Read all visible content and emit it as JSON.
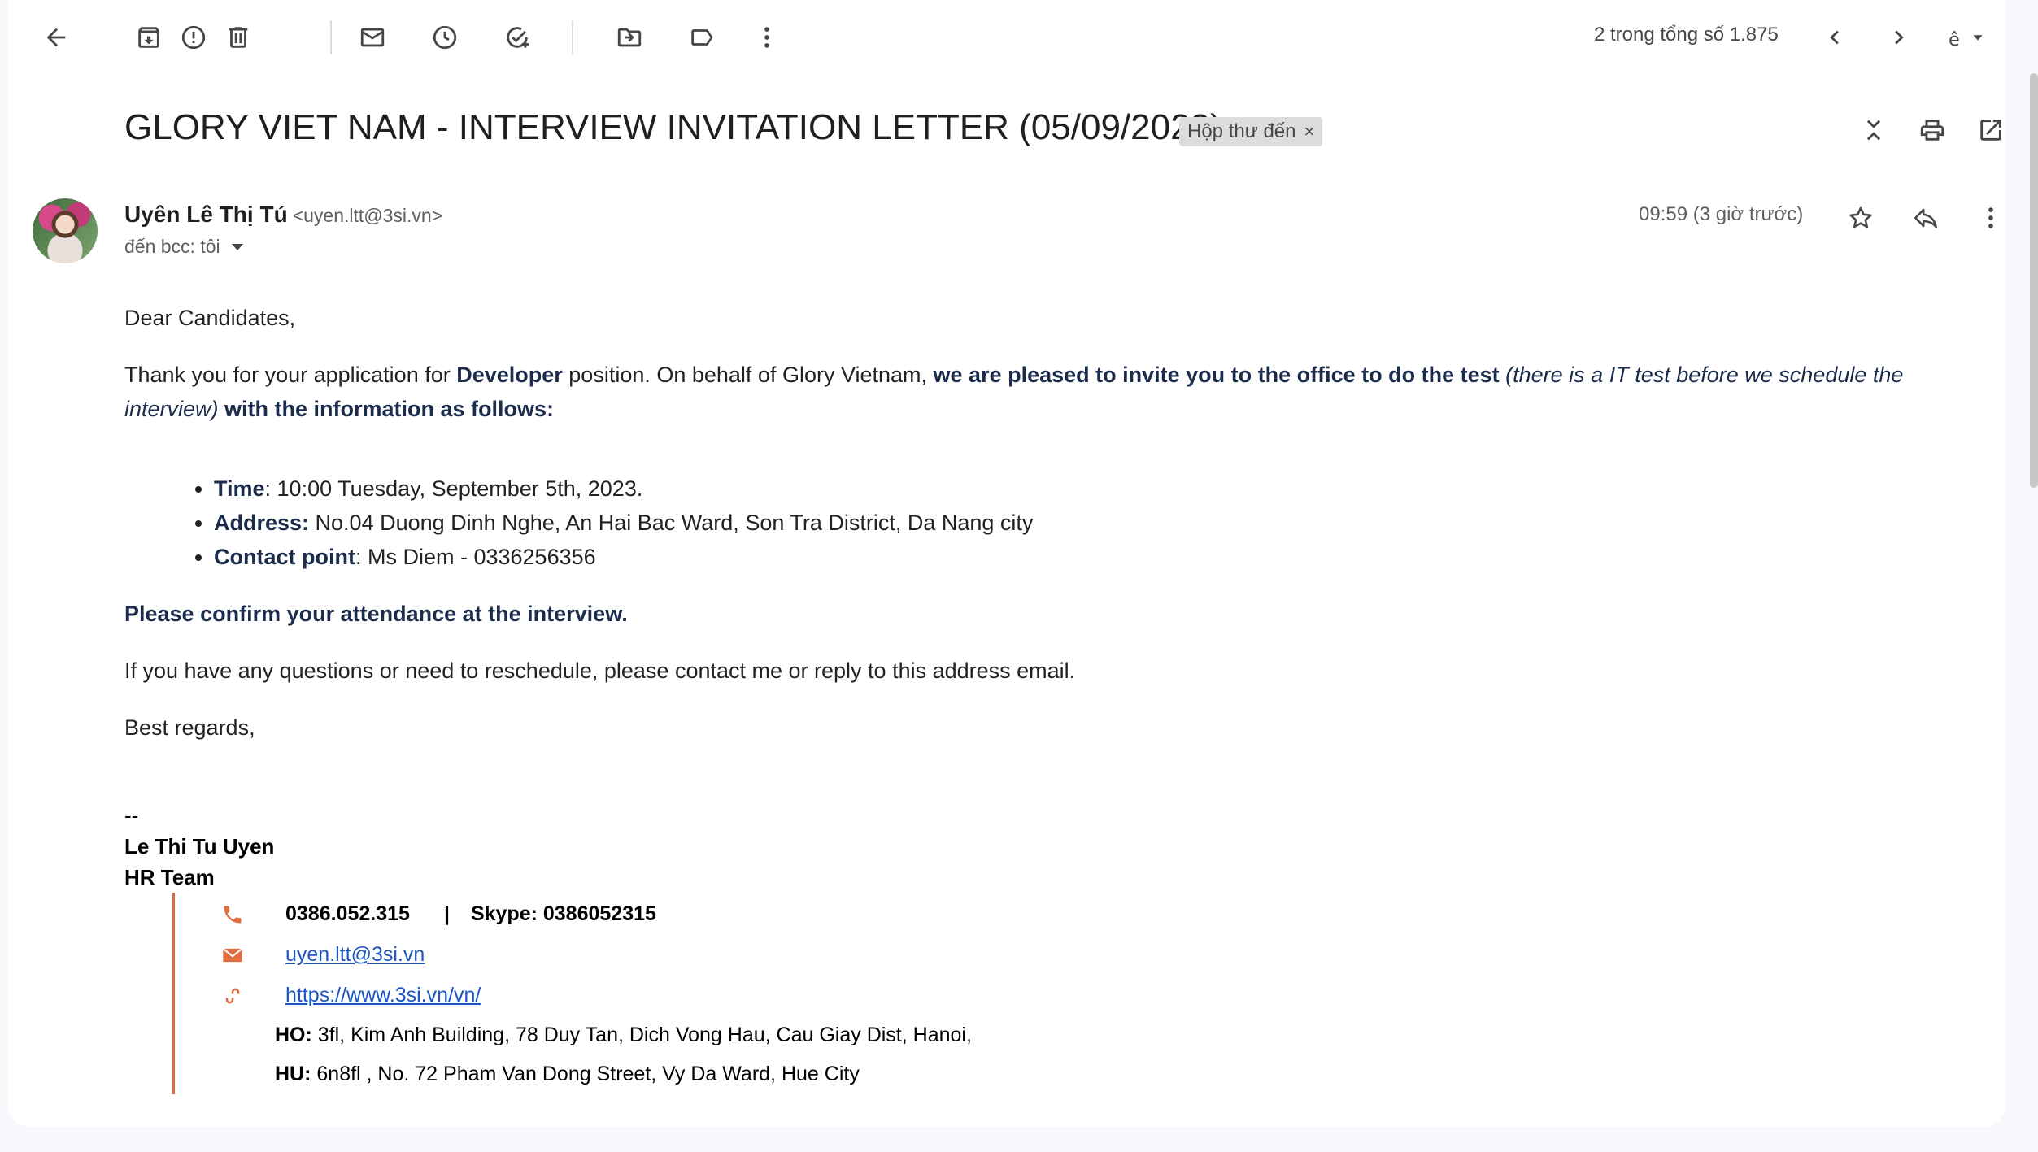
{
  "toolbar": {
    "pager_text": "2 trong tổng số 1.875"
  },
  "email": {
    "subject": "GLORY VIET NAM - INTERVIEW INVITATION LETTER (05/09/2023)",
    "label_chip": "Hộp thư đến",
    "label_close": "×",
    "sender_name": "Uyên Lê Thị Tú",
    "sender_email": "<uyen.ltt@3si.vn>",
    "recipient": "đến bcc: tôi",
    "time": "09:59 (3 giờ trước)"
  },
  "body": {
    "greeting": "Dear Candidates,",
    "p1_a": "Thank you for your application for ",
    "p1_b": "Developer",
    "p1_c": " position. On behalf of Glory Vietnam, ",
    "p1_d": "we are pleased to invite you to the office to do the test",
    "p1_e": " (there is a IT test before we schedule the interview)",
    "p1_f": " with the information as follows:",
    "items": [
      {
        "label": "Time",
        "text": ": 10:00 Tuesday, September 5th, 2023."
      },
      {
        "label": "Address:",
        "text": " No.04 Duong Dinh Nghe, An Hai Bac Ward, Son Tra District, Da Nang city"
      },
      {
        "label": "Contact point",
        "text": ": Ms Diem - 0336256356"
      }
    ],
    "confirm": "Please confirm your attendance at the interview.",
    "questions": "If you have any questions or need to reschedule, please contact me or reply to this address email.",
    "regards": "Best regards,"
  },
  "signature": {
    "dashes": "--",
    "name": "Le Thi Tu Uyen",
    "team": "HR Team",
    "phone": "0386.052.315",
    "separator": "|",
    "skype": "Skype: 0386052315",
    "email": "uyen.ltt@3si.vn",
    "website": "https://www.3si.vn/vn/",
    "ho_label": "HO:",
    "ho_text": " 3fl, Kim Anh Building, 78 Duy Tan, Dich Vong Hau, Cau Giay Dist, Hanoi,",
    "hu_label": "HU:",
    "hu_text": " 6n8fl , No. 72 Pham Van Dong Street, Vy Da Ward, Hue City"
  },
  "colors": {
    "accent_orange": "#e06d3f",
    "navy_text": "#1c2c4c",
    "link": "#1a55c4"
  }
}
